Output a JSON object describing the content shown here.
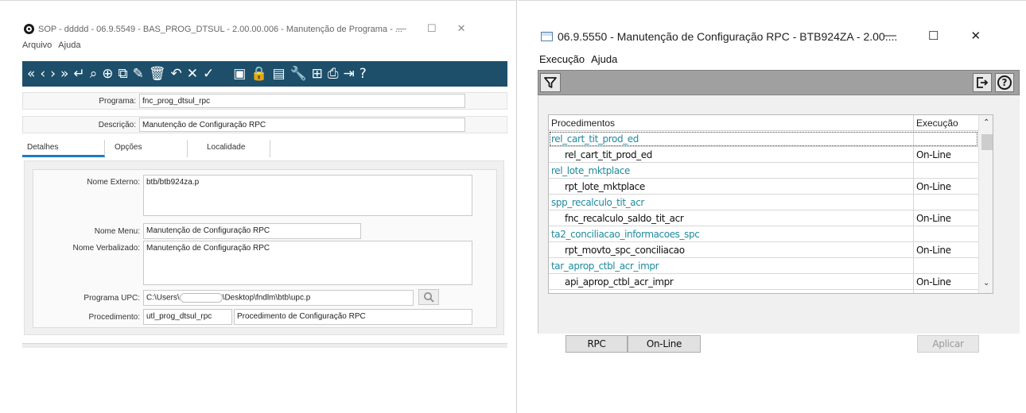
{
  "left_window": {
    "title": "SOP - ddddd - 06.9.5549 - BAS_PROG_DTSUL - 2.00.00.006 - Manutenção de Programa - ...",
    "menu": [
      "Arquivo",
      "Ajuda"
    ],
    "toolbar_icons": [
      "first-icon",
      "prev-icon",
      "next-icon",
      "last-icon",
      "goto-icon",
      "search-icon",
      "new-icon",
      "copy-icon",
      "edit-icon",
      "delete-icon",
      "undo-icon",
      "cancel-icon",
      "confirm-icon",
      "code-icon",
      "lock-icon",
      "image-icon",
      "tools-icon",
      "tree-icon",
      "print-icon",
      "exit-icon",
      "help-icon"
    ],
    "programa_label": "Programa:",
    "programa_value": "fnc_prog_dtsul_rpc",
    "descricao_label": "Descrição:",
    "descricao_value": "Manutenção de Configuração RPC",
    "tabs": [
      "Detalhes",
      "Opções",
      "Localidade"
    ],
    "nome_externo_label": "Nome Externo:",
    "nome_externo_value": "btb/btb924za.p",
    "nome_menu_label": "Nome Menu:",
    "nome_menu_value": "Manutenção de Configuração RPC",
    "nome_verbalizado_label": "Nome Verbalizado:",
    "nome_verbalizado_value": "Manutenção de Configuração RPC",
    "programa_upc_label": "Programa UPC:",
    "programa_upc_prefix": "C:\\Users\\",
    "programa_upc_suffix": "\\Desktop\\fndlm\\btb\\upc.p",
    "procedimento_label": "Procedimento:",
    "procedimento_code": "utl_prog_dtsul_rpc",
    "procedimento_desc": "Procedimento de Configuração RPC"
  },
  "right_window": {
    "title": "06.9.5550 - Manutenção de Configuração RPC - BTB924ZA - 2.00....",
    "menu": [
      "Execução",
      "Ajuda"
    ],
    "columns": [
      "Procedimentos",
      "Execução"
    ],
    "rows": [
      {
        "type": "group",
        "name": "rel_cart_tit_prod_ed",
        "exec": ""
      },
      {
        "type": "child",
        "name": "rel_cart_tit_prod_ed",
        "exec": "On-Line"
      },
      {
        "type": "group",
        "name": "rel_lote_mktplace",
        "exec": ""
      },
      {
        "type": "child",
        "name": "rpt_lote_mktplace",
        "exec": "On-Line"
      },
      {
        "type": "group",
        "name": "spp_recalculo_tit_acr",
        "exec": ""
      },
      {
        "type": "child",
        "name": "fnc_recalculo_saldo_tit_acr",
        "exec": "On-Line"
      },
      {
        "type": "group",
        "name": "ta2_conciliacao_informacoes_spc",
        "exec": ""
      },
      {
        "type": "child",
        "name": "rpt_movto_spc_conciliacao",
        "exec": "On-Line"
      },
      {
        "type": "group",
        "name": "tar_aprop_ctbl_acr_impr",
        "exec": ""
      },
      {
        "type": "child",
        "name": "api_aprop_ctbl_acr_impr",
        "exec": "On-Line"
      }
    ],
    "buttons": {
      "rpc": "RPC",
      "online": "On-Line",
      "aplicar": "Aplicar"
    }
  },
  "colors": {
    "toolbar": "#1d4f6b",
    "tab_accent": "#1f7ac2",
    "group_row": "#1f8a9e",
    "filter_bar": "#a0a0a0"
  }
}
